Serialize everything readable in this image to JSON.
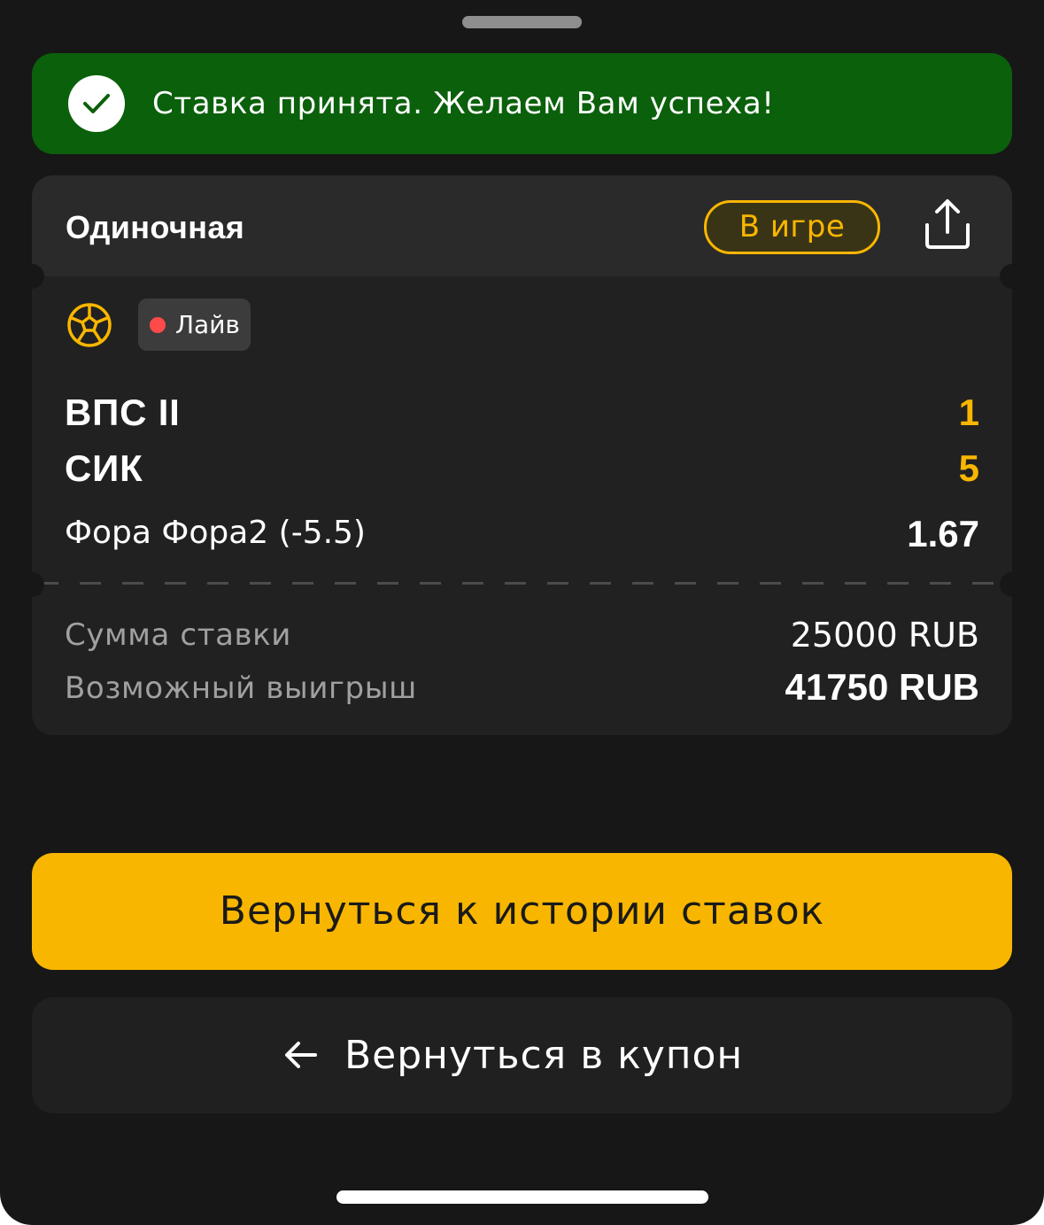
{
  "toast": {
    "message": "Ставка принята. Желаем Вам успеха!",
    "color": "#0b600b",
    "icon": "checkmark-icon"
  },
  "bet": {
    "type": "Одиночная",
    "status": "В игре",
    "share_icon": "share-icon",
    "sport_icon": "soccer-ball-icon",
    "live_label": "Лайв",
    "teams": [
      {
        "name": "ВПС II",
        "score": "1"
      },
      {
        "name": "СИК",
        "score": "5"
      }
    ],
    "market": "Фора Фора2 (-5.5)",
    "odds": "1.67",
    "stake_label": "Сумма ставки",
    "stake_value": "25000 RUB",
    "win_label": "Возможный выигрыш",
    "win_value": "41750 RUB"
  },
  "actions": {
    "history_button": "Вернуться к истории ставок",
    "coupon_button": "Вернуться в купон",
    "back_icon": "arrow-left-icon"
  },
  "colors": {
    "accent": "#f8b600",
    "background": "#171717",
    "card": "#212121",
    "card_header": "#2a2a2a",
    "live_dot": "#ff4a4a"
  }
}
